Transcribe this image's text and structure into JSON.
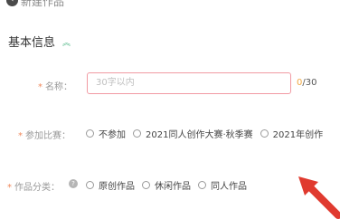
{
  "header": {
    "back_icon": "back-circle-icon",
    "title": "新建作品"
  },
  "section": {
    "title": "基本信息",
    "collapse_icon": "chevron-up-icon"
  },
  "form": {
    "name": {
      "required_mark": "*",
      "label": "名称：",
      "placeholder": "30字以内",
      "current_count": "0",
      "max_count": "/30",
      "border_color": "#f19aa3"
    },
    "competition": {
      "required_mark": "*",
      "label": "参加比赛：",
      "options": [
        "不参加",
        "2021同人创作大赛·秋季赛",
        "2021年创作"
      ]
    },
    "category": {
      "required_mark": "*",
      "label": "作品分类：",
      "help_icon": "question-circle-icon",
      "options": [
        "原创作品",
        "休闲作品",
        "同人作品"
      ]
    }
  },
  "annotation": {
    "arrow_color": "#e03a2f"
  }
}
